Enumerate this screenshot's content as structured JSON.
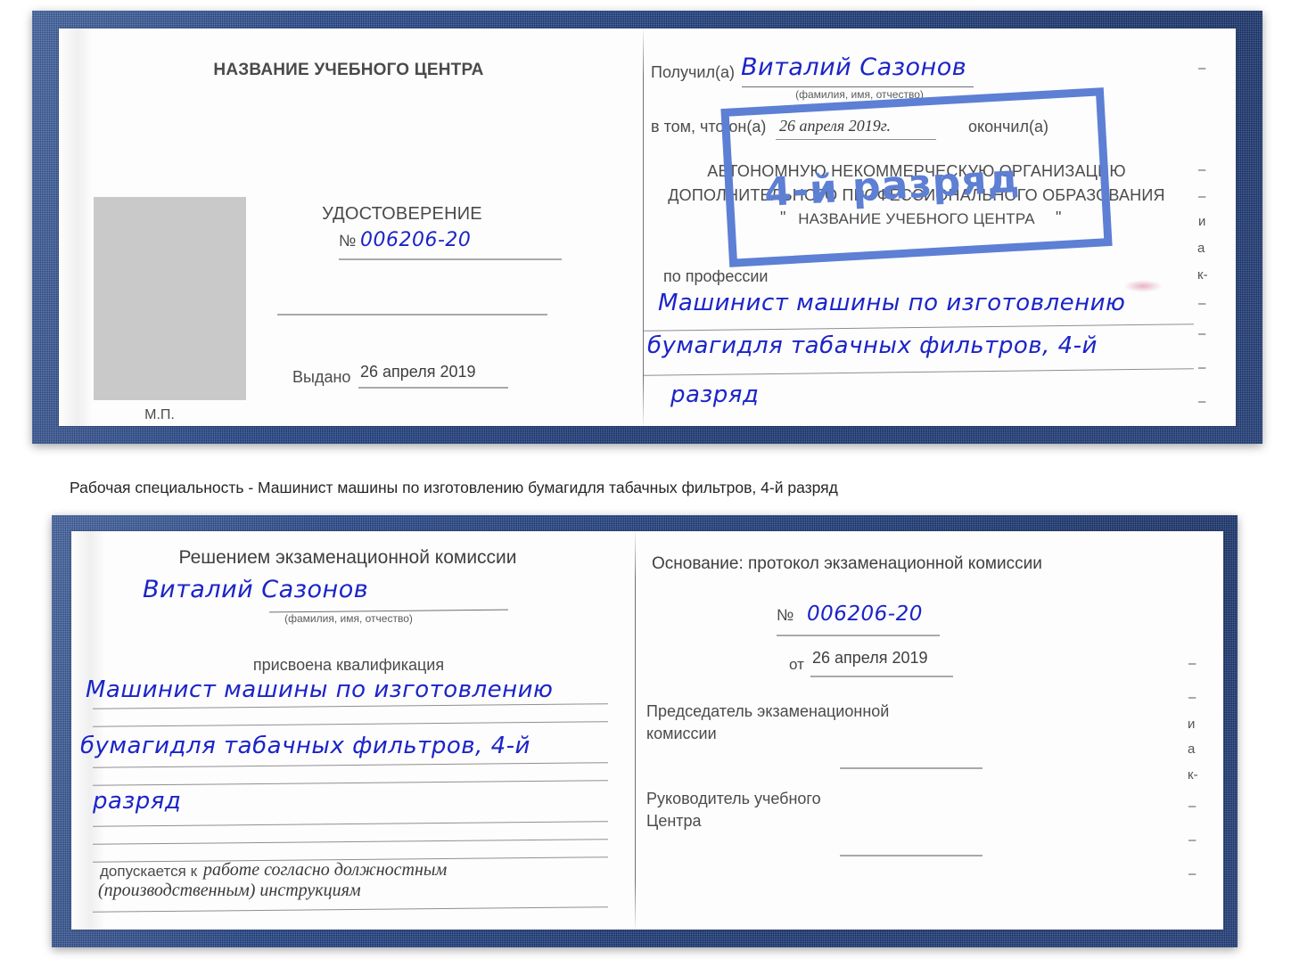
{
  "caption": {
    "text": "Рабочая специальность - Машинист машины по изготовлению бумагидля табачных фильтров, 4-й разряд"
  },
  "colors": {
    "cover_blue": "#21448a",
    "handwriting_blue": "#1b24c8",
    "stamp_blue": "#5d7fd4",
    "paper": "#fdfdfd",
    "photo_placeholder": "#c9c9c9",
    "body_text": "#4b4b4e"
  },
  "certificate_front": {
    "left_page": {
      "org_title": "НАЗВАНИЕ УЧЕБНОГО ЦЕНТРА",
      "doc_type": "УДОСТОВЕРЕНИЕ",
      "number_label": "№",
      "number_value": "006206-20",
      "issued_label": "Выдано",
      "issued_value": "26 апреля 2019",
      "seal_label": "М.П.",
      "photo_placeholder_label": "photo-placeholder"
    },
    "right_page": {
      "received_label": "Получил(а)",
      "received_value": "Виталий Сазонов",
      "fio_hint": "(фамилия, имя, отчество)",
      "in_that_label": "в том, что он(а)",
      "in_that_date": "26 апреля 2019г.",
      "finished_label": "окончил(а)",
      "org_line_1": "АВТОНОМНУЮ НЕКОММЕРЧЕСКУЮ ОРГАНИЗАЦИЮ",
      "org_line_2": "ДОПОЛНИТЕЛЬНОГО ПРОФЕССИОНАЛЬНОГО ОБРАЗОВАНИЯ",
      "org_quote_open": "\"",
      "org_line_3": "НАЗВАНИЕ УЧЕБНОГО ЦЕНТРА",
      "org_quote_close": "\"",
      "profession_label": "по профессии",
      "profession_line_1": "Машинист машины по изготовлению",
      "profession_line_2": "бумагидля табачных фильтров, 4-й",
      "profession_line_3": "разряд",
      "stamp_text": "4-й разряд",
      "edge_ghost": [
        "–",
        "–",
        "–",
        "и",
        "а",
        "к-",
        "–",
        "–",
        "–",
        "–"
      ]
    }
  },
  "certificate_back": {
    "left_page": {
      "heading": "Решением экзаменационной комиссии",
      "name_value": "Виталий Сазонов",
      "fio_hint": "(фамилия, имя, отчество)",
      "qualification_label": "присвоена квалификация",
      "qualification_line_1": "Машинист машины по изготовлению",
      "qualification_line_2": "бумагидля табачных фильтров, 4-й",
      "qualification_line_3": "разряд",
      "allowed_label": "допускается к",
      "allowed_value_line_1": "работе согласно должностным",
      "allowed_value_line_2": "(производственным) инструкциям"
    },
    "right_page": {
      "basis_label": "Основание: протокол экзаменационной комиссии",
      "number_label": "№",
      "number_value": "006206-20",
      "date_label": "от",
      "date_value": "26 апреля 2019",
      "chairman_line_1": "Председатель экзаменационной",
      "chairman_line_2": "комиссии",
      "head_line_1": "Руководитель учебного",
      "head_line_2": "Центра",
      "edge_ghost": [
        "–",
        "–",
        "и",
        "а",
        "к-",
        "–",
        "–",
        "–"
      ]
    }
  }
}
